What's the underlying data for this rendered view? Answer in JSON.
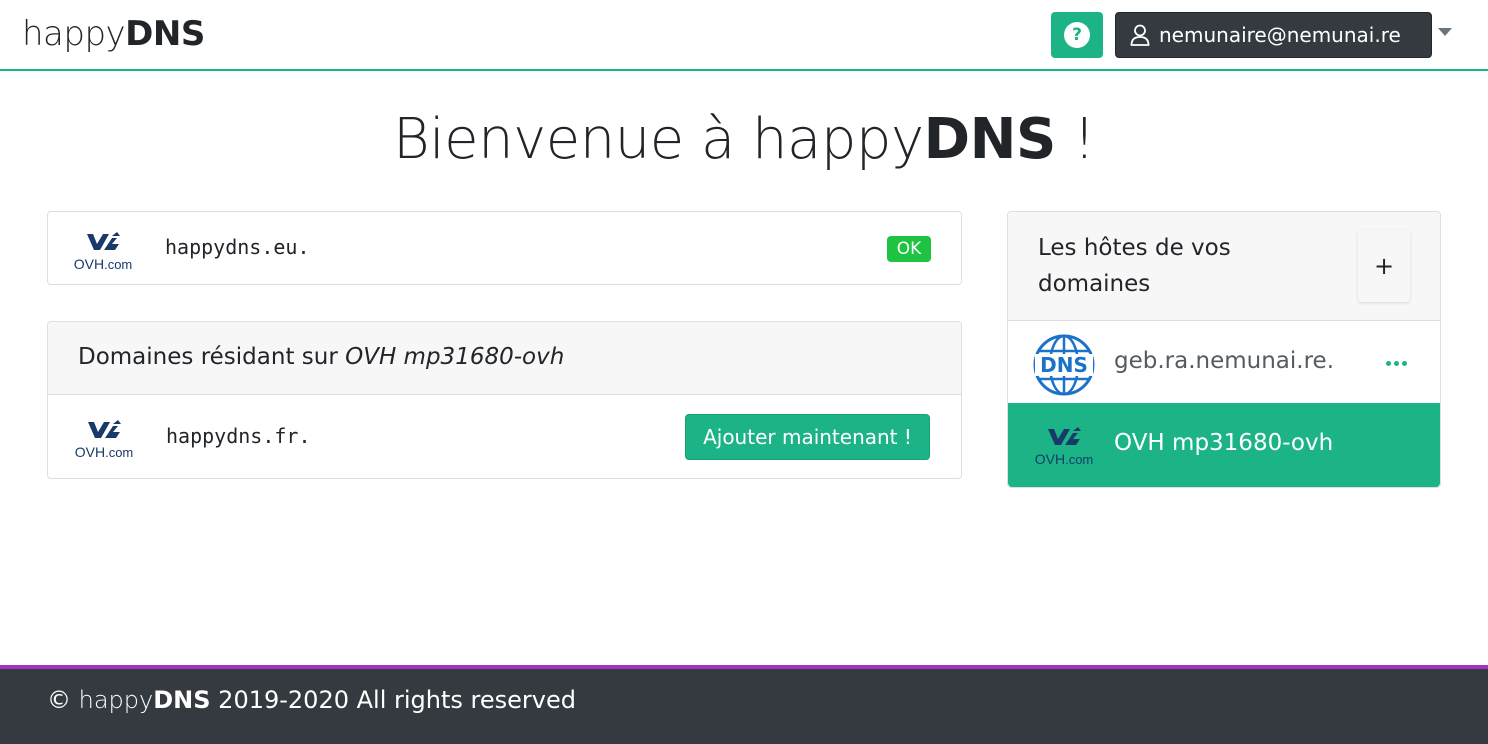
{
  "header": {
    "brand_light": "happy",
    "brand_bold": "DNS",
    "help_label": "?",
    "user_email": "nemunaire@nemunai.re"
  },
  "welcome": {
    "prefix": "Bienvenue à happy",
    "bold": "DNS",
    "suffix": " !"
  },
  "provider_logo": {
    "main": "OVH",
    "sub": ".com"
  },
  "domain_card": {
    "domain": "happydns.eu.",
    "status": "OK"
  },
  "residents": {
    "header_prefix": "Domaines résidant sur ",
    "header_source": "OVH mp31680-ovh",
    "domain": "happydns.fr.",
    "add_label": "Ajouter maintenant !"
  },
  "hosts": {
    "header": "Les hôtes de vos domaines",
    "add_label": "+",
    "items": [
      {
        "label": "geb.ra.nemunai.re.",
        "icon": "dns-globe-icon"
      },
      {
        "label": "OVH mp31680-ovh",
        "icon": "ovh-logo-icon",
        "active": true
      }
    ]
  },
  "footer": {
    "copyright": "©",
    "brand_light": "happy",
    "brand_bold": "DNS",
    "text": "2019-2020 All rights reserved"
  },
  "colors": {
    "accent": "#1cb487",
    "ok": "#1ec441",
    "dark": "#343a40",
    "footer_border": "#9c35c4"
  }
}
